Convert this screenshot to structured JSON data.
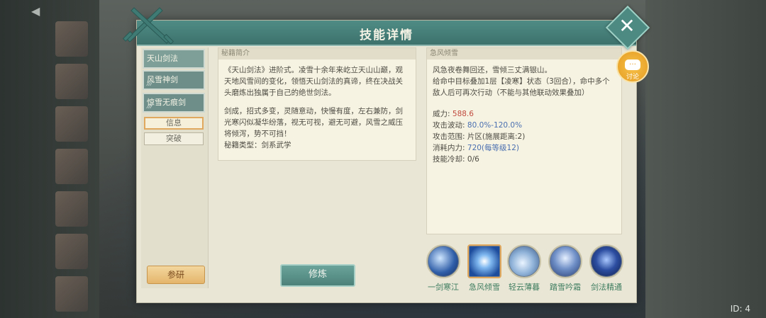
{
  "background": {
    "id_label": "ID: 4"
  },
  "dialog": {
    "title": "技能详情",
    "close_label": "✕",
    "tabs": [
      {
        "label": "天山剑法",
        "dots": ""
      },
      {
        "label": "风雪神剑",
        "dots": "⁄ ⁄ ⁄"
      },
      {
        "label": "惊雪无痕剑",
        "dots": "⁄ ⁄ ⁄"
      }
    ],
    "sub_tabs": [
      {
        "label": "信息",
        "selected": true
      },
      {
        "label": "突破",
        "selected": false
      }
    ],
    "study_button": "参研",
    "cultivate_button": "修炼",
    "chat_button": {
      "icon": "…",
      "label": "讨论"
    }
  },
  "secret_intro": {
    "header": "秘籍简介",
    "para1": "《天山剑法》进阶式。凌雪十余年来屹立天山山巅，观天地风雪间的变化，领悟天山剑法的真谛，终在决战关头磨炼出独属于自己的绝世剑法。",
    "para2": "剑成，招式多变，灵随意动，快慢有度，左右兼防，剑光寒闪似凝华纷落，视无可视，避无可避，风雪之威压将倾泻，势不可挡！",
    "type_label": "秘籍类型：剑系武学"
  },
  "skill_detail": {
    "header": "急风倾雪",
    "desc1": "风急夜卷舞回还，雪倾三丈满银山。",
    "desc2": "给命中目标叠加1层【凌寒】状态（3回合），命中多个敌人后可再次行动（不能与其他联动效果叠加）",
    "stats": [
      {
        "key": "威力:",
        "value": "588.6",
        "color": "#c04a3e"
      },
      {
        "key": "攻击波动:",
        "value": "80.0%-120.0%",
        "color": "#4a6fb0"
      },
      {
        "key": "攻击范围:",
        "value": "片区(施展距离:2)",
        "color": ""
      },
      {
        "key": "消耗内力:",
        "value": "720(每等级12)",
        "color": "#4a6fb0"
      },
      {
        "key": "技能冷却:",
        "value": "0/6",
        "color": ""
      }
    ]
  },
  "skills": [
    {
      "name": "一剑寒江",
      "icon": "sword-ice-icon",
      "selected": false
    },
    {
      "name": "急风倾雪",
      "icon": "snow-burst-icon",
      "selected": true
    },
    {
      "name": "轻云薄暮",
      "icon": "cloud-icon",
      "selected": false
    },
    {
      "name": "踏雪吟霜",
      "icon": "swordsman-icon",
      "selected": false
    },
    {
      "name": "剑法精通",
      "icon": "mastery-icon",
      "selected": false
    }
  ]
}
